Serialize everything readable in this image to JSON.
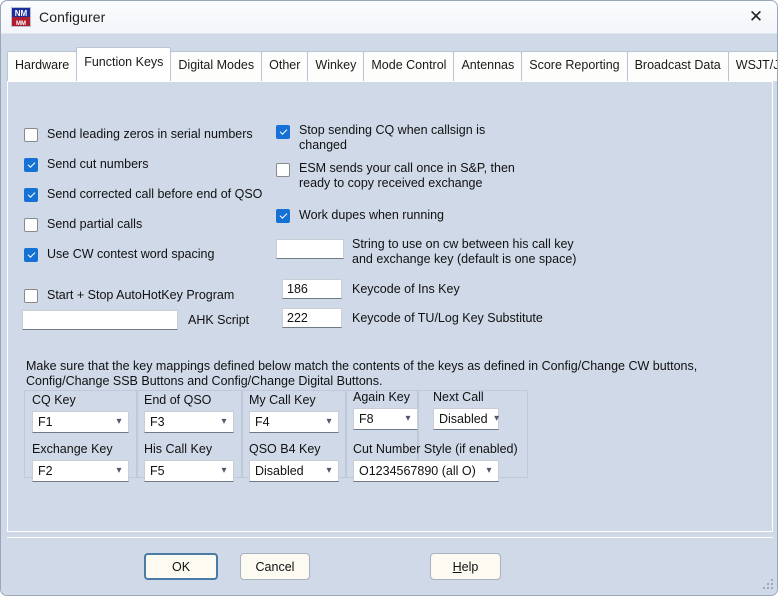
{
  "window": {
    "title": "Configurer",
    "icon": "n1mm-logo-icon",
    "close_label": "✕"
  },
  "tabs": [
    {
      "label": "Hardware",
      "active": false
    },
    {
      "label": "Function Keys",
      "active": true
    },
    {
      "label": "Digital Modes",
      "active": false
    },
    {
      "label": "Other",
      "active": false
    },
    {
      "label": "Winkey",
      "active": false
    },
    {
      "label": "Mode Control",
      "active": false
    },
    {
      "label": "Antennas",
      "active": false
    },
    {
      "label": "Score Reporting",
      "active": false
    },
    {
      "label": "Broadcast Data",
      "active": false
    },
    {
      "label": "WSJT/JTDX Setup",
      "active": false
    }
  ],
  "checkboxes_left": [
    {
      "label": "Send leading zeros in serial numbers",
      "checked": false
    },
    {
      "label": "Send cut numbers",
      "checked": true
    },
    {
      "label": "Send corrected call before end of QSO",
      "checked": true
    },
    {
      "label": "Send partial calls",
      "checked": false
    },
    {
      "label": "Use CW contest word spacing",
      "checked": true
    },
    {
      "label": "Start + Stop AutoHotKey Program",
      "checked": false
    }
  ],
  "checkboxes_right": [
    {
      "label": "Stop sending CQ when callsign is\nchanged",
      "checked": true
    },
    {
      "label": "ESM sends your call once in S&P, then\nready to copy received exchange",
      "checked": false
    },
    {
      "label": "Work dupes when running",
      "checked": true
    }
  ],
  "text_fields": {
    "ahk_script": {
      "value": "",
      "label": "AHK Script"
    },
    "cw_string": {
      "value": "",
      "label": "String to use on cw between his call key\nand exchange key (default is one space)"
    },
    "ins_keycode": {
      "value": "186",
      "label": "Keycode of Ins Key"
    },
    "tu_log_keycode": {
      "value": "222",
      "label": "Keycode of TU/Log Key Substitute"
    }
  },
  "instructions": "Make sure that the key mappings defined below match the contents of the keys as defined in Config/Change CW buttons,\nConfig/Change SSB Buttons and Config/Change Digital Buttons.",
  "key_mappings": [
    {
      "label": "CQ Key",
      "value": "F1"
    },
    {
      "label": "End of QSO",
      "value": "F3"
    },
    {
      "label": "My Call Key",
      "value": "F4"
    },
    {
      "label": "Again  Key",
      "value": "F8"
    },
    {
      "label": "Next Call",
      "value": "Disabled"
    },
    {
      "label": "Exchange  Key",
      "value": "F2"
    },
    {
      "label": "His Call Key",
      "value": "F5"
    },
    {
      "label": "QSO B4 Key",
      "value": "Disabled"
    },
    {
      "label": "Cut Number Style (if enabled)",
      "value": "O1234567890 (all O)"
    }
  ],
  "footer": {
    "ok_label": "OK",
    "cancel_label": "Cancel",
    "help_prefix": "H",
    "help_suffix": "elp"
  },
  "colors": {
    "dialog_bg": "#cfd9e8",
    "checkbox_checked": "#1571d3",
    "tab_active_bg": "#ffffff",
    "button_bg": "#fdfaf1",
    "default_button_border": "#4a7ba6"
  }
}
